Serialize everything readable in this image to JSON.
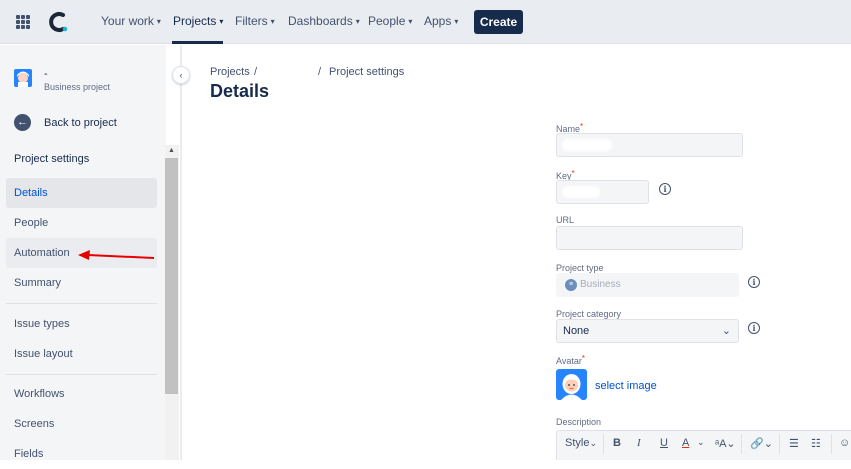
{
  "nav": {
    "items": [
      {
        "label": "Your work"
      },
      {
        "label": "Projects"
      },
      {
        "label": "Filters"
      },
      {
        "label": "Dashboards"
      },
      {
        "label": "People"
      },
      {
        "label": "Apps"
      }
    ],
    "create_label": "Create",
    "active": "Projects"
  },
  "sidebar": {
    "project_name": "-",
    "project_type": "Business project",
    "back_label": "Back to project",
    "section_title": "Project settings",
    "items": [
      {
        "label": "Details"
      },
      {
        "label": "People"
      },
      {
        "label": "Automation"
      },
      {
        "label": "Summary"
      },
      {
        "label": "Issue types"
      },
      {
        "label": "Issue layout"
      },
      {
        "label": "Workflows"
      },
      {
        "label": "Screens"
      },
      {
        "label": "Fields"
      }
    ]
  },
  "breadcrumb": {
    "projects": "Projects",
    "sep1": "/",
    "sep2": "/",
    "settings": "Project settings"
  },
  "main": {
    "title": "Details",
    "fields": {
      "name_label": "Name",
      "key_label": "Key",
      "url_label": "URL",
      "project_type_label": "Project type",
      "project_type_value": "Business",
      "project_category_label": "Project category",
      "project_category_value": "None",
      "avatar_label": "Avatar",
      "select_image": "select image",
      "description_label": "Description",
      "required_mark": "*"
    },
    "toolbar": {
      "style": "Style",
      "bold": "B",
      "italic": "I",
      "underline": "U",
      "color": "A"
    }
  },
  "colors": {
    "accent": "#0052cc",
    "nav_bg": "#e9ecf0",
    "create_bg": "#172b4d",
    "arrow": "#e60000"
  }
}
